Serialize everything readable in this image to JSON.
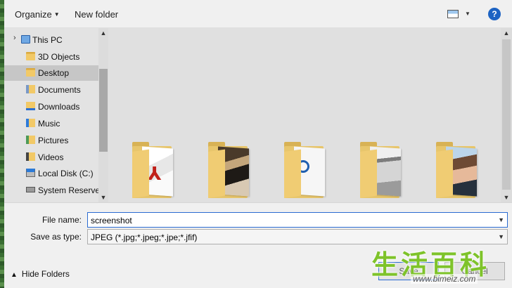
{
  "toolbar": {
    "organize_label": "Organize",
    "new_folder_label": "New folder",
    "view_icon": "view-options-icon",
    "help_label": "?"
  },
  "nav": {
    "items": [
      {
        "label": "This PC",
        "icon": "pc-icon"
      },
      {
        "label": "3D Objects",
        "icon": "folder-icon"
      },
      {
        "label": "Desktop",
        "icon": "folder-icon",
        "selected": true
      },
      {
        "label": "Documents",
        "icon": "documents-icon"
      },
      {
        "label": "Downloads",
        "icon": "downloads-icon"
      },
      {
        "label": "Music",
        "icon": "music-icon"
      },
      {
        "label": "Pictures",
        "icon": "pictures-icon"
      },
      {
        "label": "Videos",
        "icon": "videos-icon"
      },
      {
        "label": "Local Disk (C:)",
        "icon": "local-disk-icon"
      },
      {
        "label": "System Reserved",
        "icon": "drive-icon"
      }
    ]
  },
  "form": {
    "file_name_label": "File name:",
    "file_name_value": "screenshot",
    "save_type_label": "Save as type:",
    "save_type_value": "JPEG (*.jpg;*.jpeg;*.jpe;*.jfif)",
    "hide_folders_label": "Hide Folders",
    "save_label": "Save",
    "cancel_label": "Cancel"
  },
  "watermark": {
    "chars": "生活百科",
    "url": "www.bimeiz.com"
  },
  "colors": {
    "accent": "#2a6bd1",
    "help": "#1d63c3",
    "watermark": "#7ec32a"
  }
}
